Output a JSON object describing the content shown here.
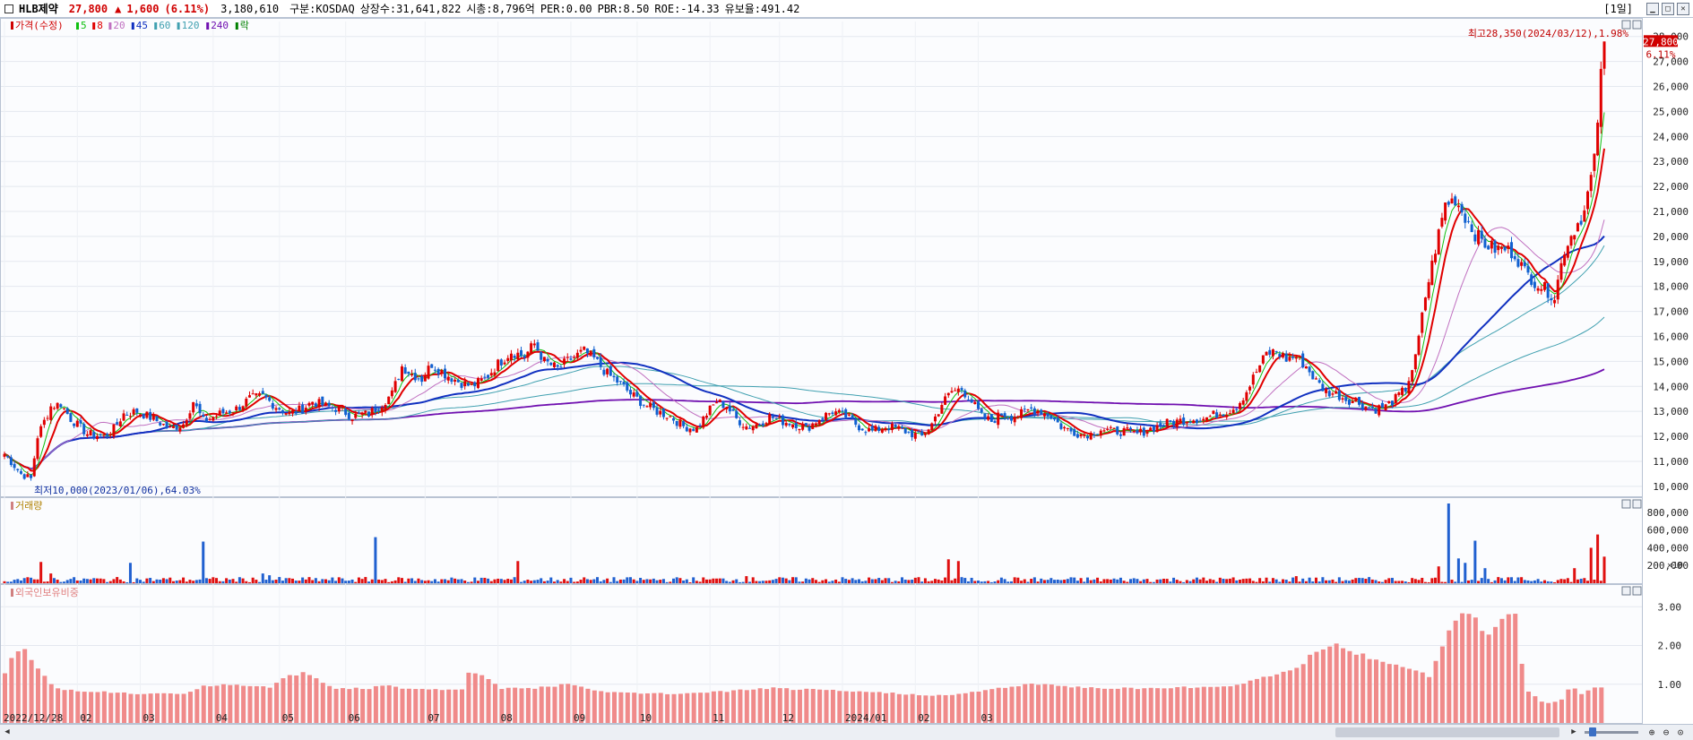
{
  "header": {
    "stock_name": "HLB제약",
    "price": "27,800",
    "arrow": "▲",
    "change": "1,600",
    "change_pct": "(6.11%)",
    "volume": "3,180,610",
    "market": "구분:KOSDAQ",
    "shares": "상장수:31,641,822",
    "market_cap": "시총:8,796억",
    "per": "PER:0.00",
    "pbr": "PBR:8.50",
    "roe": "ROE:-14.33",
    "reserve": "유보율:491.42",
    "period": "[1일]"
  },
  "chart_data": {
    "type": "candlestick",
    "price_legend": {
      "label": "가격(수정)",
      "ma": [
        {
          "name": "5",
          "color": "#10c010"
        },
        {
          "name": "8",
          "color": "#e00000"
        },
        {
          "name": "20",
          "color": "#c070c0"
        },
        {
          "name": "45",
          "color": "#1030c0"
        },
        {
          "name": "60",
          "color": "#40a0b0"
        },
        {
          "name": "120",
          "color": "#40a0b0"
        },
        {
          "name": "240",
          "color": "#7010b0"
        },
        {
          "name": "락",
          "color": "#008000"
        }
      ]
    },
    "y_ticks": [
      "10,000",
      "11,000",
      "12,000",
      "13,000",
      "14,000",
      "15,000",
      "16,000",
      "17,000",
      "18,000",
      "19,000",
      "20,000",
      "21,000",
      "22,000",
      "23,000",
      "24,000",
      "25,000",
      "26,000",
      "27,000",
      "28,000"
    ],
    "ylim": [
      9600,
      28600
    ],
    "x_ticks": [
      "2022/12/28",
      "02",
      "03",
      "04",
      "05",
      "06",
      "07",
      "08",
      "09",
      "10",
      "11",
      "12",
      "2024/01",
      "02",
      "03"
    ],
    "current_price": {
      "label": "27,800",
      "pct": "6.11%"
    },
    "annotations": {
      "high": "최고28,350(2024/03/12),1.98%",
      "low": "최저10,000(2023/01/06),64.03%"
    },
    "price_anchors": [
      [
        0,
        11300
      ],
      [
        5,
        10500
      ],
      [
        8,
        10300
      ],
      [
        10,
        12000
      ],
      [
        14,
        13200
      ],
      [
        17,
        13300
      ],
      [
        20,
        12700
      ],
      [
        25,
        12100
      ],
      [
        30,
        12000
      ],
      [
        33,
        12300
      ],
      [
        36,
        12900
      ],
      [
        40,
        13000
      ],
      [
        45,
        12700
      ],
      [
        50,
        12300
      ],
      [
        54,
        12500
      ],
      [
        57,
        13400
      ],
      [
        60,
        12600
      ],
      [
        65,
        12900
      ],
      [
        70,
        13100
      ],
      [
        74,
        13500
      ],
      [
        78,
        13600
      ],
      [
        82,
        13200
      ],
      [
        86,
        12900
      ],
      [
        90,
        13100
      ],
      [
        93,
        13400
      ],
      [
        97,
        13200
      ],
      [
        101,
        13100
      ],
      [
        105,
        12800
      ],
      [
        110,
        12900
      ],
      [
        113,
        13200
      ],
      [
        117,
        13700
      ],
      [
        120,
        14800
      ],
      [
        123,
        14500
      ],
      [
        126,
        14300
      ],
      [
        129,
        14900
      ],
      [
        133,
        14500
      ],
      [
        137,
        14200
      ],
      [
        141,
        14000
      ],
      [
        145,
        14300
      ],
      [
        149,
        14900
      ],
      [
        153,
        15400
      ],
      [
        157,
        15200
      ],
      [
        160,
        15700
      ],
      [
        163,
        15000
      ],
      [
        167,
        14700
      ],
      [
        171,
        15100
      ],
      [
        175,
        15400
      ],
      [
        178,
        15100
      ],
      [
        182,
        14500
      ],
      [
        186,
        14100
      ],
      [
        189,
        13700
      ],
      [
        193,
        13300
      ],
      [
        197,
        13000
      ],
      [
        201,
        12800
      ],
      [
        205,
        12400
      ],
      [
        209,
        12300
      ],
      [
        212,
        12900
      ],
      [
        215,
        13400
      ],
      [
        218,
        13200
      ],
      [
        221,
        12700
      ],
      [
        224,
        12400
      ],
      [
        228,
        12500
      ],
      [
        231,
        12800
      ],
      [
        235,
        12600
      ],
      [
        239,
        12500
      ],
      [
        242,
        12300
      ],
      [
        246,
        12700
      ],
      [
        250,
        13000
      ],
      [
        254,
        12800
      ],
      [
        258,
        12400
      ],
      [
        262,
        12200
      ],
      [
        266,
        12400
      ],
      [
        270,
        12300
      ],
      [
        274,
        12100
      ],
      [
        277,
        12000
      ],
      [
        280,
        12500
      ],
      [
        283,
        13300
      ],
      [
        286,
        13800
      ],
      [
        289,
        13900
      ],
      [
        292,
        13400
      ],
      [
        295,
        12800
      ],
      [
        298,
        12600
      ],
      [
        301,
        12900
      ],
      [
        304,
        12800
      ],
      [
        307,
        12900
      ],
      [
        310,
        13100
      ],
      [
        313,
        13000
      ],
      [
        316,
        12800
      ],
      [
        319,
        12400
      ],
      [
        322,
        12200
      ],
      [
        325,
        12100
      ],
      [
        328,
        12100
      ],
      [
        331,
        12300
      ],
      [
        334,
        12200
      ],
      [
        338,
        12200
      ],
      [
        342,
        12100
      ],
      [
        346,
        12300
      ],
      [
        350,
        12500
      ],
      [
        354,
        12600
      ],
      [
        358,
        12700
      ],
      [
        362,
        12700
      ],
      [
        366,
        12900
      ],
      [
        369,
        13000
      ],
      [
        372,
        13200
      ],
      [
        375,
        13800
      ],
      [
        378,
        14600
      ],
      [
        381,
        15300
      ],
      [
        384,
        15400
      ],
      [
        387,
        15100
      ],
      [
        390,
        15200
      ],
      [
        393,
        14800
      ],
      [
        396,
        14200
      ],
      [
        399,
        13800
      ],
      [
        402,
        13700
      ],
      [
        405,
        13500
      ],
      [
        408,
        13400
      ],
      [
        411,
        13200
      ],
      [
        414,
        13100
      ],
      [
        417,
        13200
      ],
      [
        420,
        13500
      ],
      [
        423,
        13900
      ],
      [
        426,
        15100
      ],
      [
        429,
        17600
      ],
      [
        432,
        19500
      ],
      [
        435,
        21300
      ],
      [
        438,
        21500
      ],
      [
        441,
        20800
      ],
      [
        444,
        20100
      ],
      [
        447,
        19700
      ],
      [
        450,
        19500
      ],
      [
        453,
        19500
      ],
      [
        456,
        19300
      ],
      [
        459,
        18600
      ],
      [
        462,
        18200
      ],
      [
        465,
        17900
      ],
      [
        468,
        17600
      ],
      [
        471,
        19500
      ],
      [
        474,
        20300
      ],
      [
        477,
        21000
      ],
      [
        480,
        23000
      ],
      [
        482,
        26400
      ],
      [
        483,
        27800
      ]
    ],
    "volume_legend": "거래량",
    "volume_ticks": [
      "200,000",
      "400,000",
      "600,000",
      "800,000"
    ],
    "volume_unit": "×10",
    "volume_ylim": [
      0,
      900000
    ],
    "volume_spikes": [
      [
        11,
        240000
      ],
      [
        14,
        110000
      ],
      [
        38,
        230000
      ],
      [
        60,
        470000
      ],
      [
        78,
        110000
      ],
      [
        80,
        90000
      ],
      [
        112,
        520000
      ],
      [
        155,
        250000
      ],
      [
        224,
        80000
      ],
      [
        285,
        270000
      ],
      [
        288,
        250000
      ],
      [
        290,
        60000
      ],
      [
        390,
        80000
      ],
      [
        433,
        190000
      ],
      [
        436,
        900000
      ],
      [
        439,
        280000
      ],
      [
        441,
        230000
      ],
      [
        444,
        480000
      ],
      [
        447,
        170000
      ],
      [
        474,
        170000
      ],
      [
        479,
        400000
      ],
      [
        481,
        550000
      ],
      [
        483,
        300000
      ]
    ],
    "foreign_legend": "외국인보유비중",
    "foreign_ticks": [
      "1.00",
      "2.00",
      "3.00"
    ],
    "foreign_ylim": [
      0,
      3.4
    ],
    "foreign_anchors": [
      [
        0,
        1.3
      ],
      [
        3,
        1.8
      ],
      [
        6,
        1.9
      ],
      [
        9,
        1.5
      ],
      [
        12,
        1.2
      ],
      [
        15,
        0.9
      ],
      [
        20,
        0.85
      ],
      [
        30,
        0.8
      ],
      [
        40,
        0.75
      ],
      [
        55,
        0.75
      ],
      [
        60,
        0.95
      ],
      [
        70,
        1.0
      ],
      [
        80,
        0.9
      ],
      [
        85,
        1.2
      ],
      [
        90,
        1.3
      ],
      [
        95,
        1.1
      ],
      [
        100,
        0.9
      ],
      [
        110,
        0.9
      ],
      [
        115,
        1.0
      ],
      [
        120,
        0.9
      ],
      [
        138,
        0.85
      ],
      [
        140,
        1.3
      ],
      [
        145,
        1.2
      ],
      [
        150,
        0.9
      ],
      [
        160,
        0.9
      ],
      [
        170,
        1.0
      ],
      [
        180,
        0.8
      ],
      [
        200,
        0.75
      ],
      [
        215,
        0.8
      ],
      [
        230,
        0.9
      ],
      [
        245,
        0.85
      ],
      [
        260,
        0.8
      ],
      [
        285,
        0.7
      ],
      [
        300,
        0.9
      ],
      [
        310,
        1.0
      ],
      [
        330,
        0.9
      ],
      [
        350,
        0.9
      ],
      [
        370,
        0.95
      ],
      [
        385,
        1.3
      ],
      [
        390,
        1.4
      ],
      [
        395,
        1.8
      ],
      [
        402,
        2.0
      ],
      [
        408,
        1.8
      ],
      [
        415,
        1.6
      ],
      [
        425,
        1.4
      ],
      [
        430,
        1.2
      ],
      [
        434,
        2.0
      ],
      [
        438,
        2.7
      ],
      [
        441,
        3.0
      ],
      [
        444,
        2.7
      ],
      [
        447,
        2.2
      ],
      [
        450,
        2.5
      ],
      [
        453,
        2.9
      ],
      [
        456,
        2.8
      ],
      [
        458,
        1.5
      ],
      [
        460,
        0.8
      ],
      [
        465,
        0.5
      ],
      [
        470,
        0.6
      ],
      [
        473,
        1.0
      ],
      [
        476,
        0.75
      ],
      [
        479,
        0.9
      ],
      [
        483,
        0.9
      ]
    ]
  }
}
